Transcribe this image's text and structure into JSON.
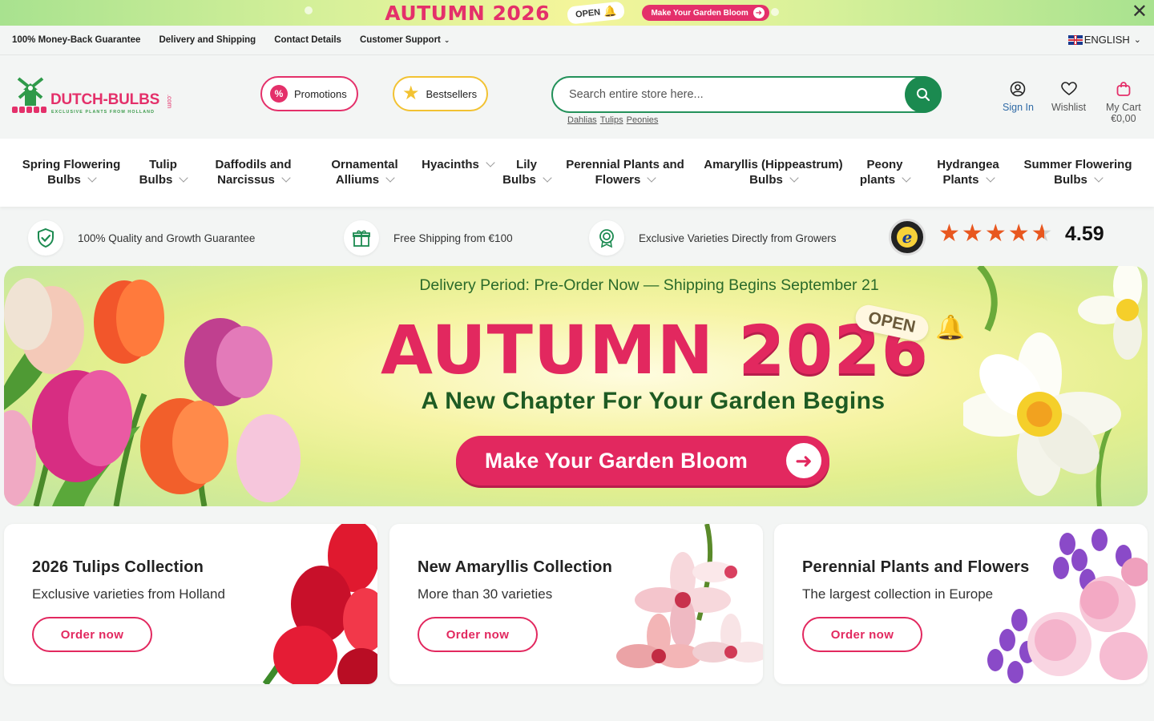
{
  "promo_strip": {
    "title": "AUTUMN 2026",
    "open_label": "OPEN",
    "cta_label": "Make Your Garden Bloom",
    "close_label": "✕"
  },
  "util_bar": {
    "links": [
      "100% Money-Back Guarantee",
      "Delivery and Shipping",
      "Contact Details",
      "Customer Support"
    ],
    "language": "ENGLISH"
  },
  "header": {
    "brand": "DUTCH-BULBS",
    "brand_suffix": ".com",
    "tagline": "EXCLUSIVE PLANTS FROM HOLLAND",
    "promotions_label": "Promotions",
    "bestsellers_label": "Bestsellers",
    "search_placeholder": "Search entire store here...",
    "quick_links": [
      "Dahlias",
      "Tulips",
      "Peonies"
    ],
    "sign_in": "Sign In",
    "wishlist": "Wishlist",
    "cart_label": "My Cart",
    "cart_total": "€0,00"
  },
  "nav": {
    "items": [
      {
        "l1": "Spring Flowering",
        "l2": "Bulbs"
      },
      {
        "l1": "Tulip",
        "l2": "Bulbs"
      },
      {
        "l1": "Daffodils and",
        "l2": "Narcissus"
      },
      {
        "l1": "Ornamental",
        "l2": "Alliums"
      },
      {
        "l1": "Hyacinths",
        "l2": ""
      },
      {
        "l1": "Lily",
        "l2": "Bulbs"
      },
      {
        "l1": "Perennial Plants and",
        "l2": "Flowers"
      },
      {
        "l1": "Amaryllis (Hippeastrum)",
        "l2": "Bulbs"
      },
      {
        "l1": "Peony",
        "l2": "plants"
      },
      {
        "l1": "Hydrangea",
        "l2": "Plants"
      },
      {
        "l1": "Summer Flowering",
        "l2": "Bulbs"
      }
    ]
  },
  "trust": {
    "items": [
      "100% Quality and Growth Guarantee",
      "Free Shipping from €100",
      "Exclusive Varieties Directly from Growers"
    ],
    "rating": "4.59",
    "rating_value": 4.59,
    "rating_max": 5
  },
  "hero": {
    "delivery": "Delivery Period: Pre-Order Now — Shipping Begins September 21",
    "headline_word": "AUTUMN",
    "headline_year": "2026",
    "open_label": "OPEN",
    "subtitle": "A New Chapter For Your Garden Begins",
    "cta_label": "Make Your Garden Bloom",
    "colors": {
      "accent": "#e2285f",
      "green": "#1e5b23"
    }
  },
  "cards": [
    {
      "title": "2026 Tulips Collection",
      "desc": "Exclusive varieties from Holland",
      "button": "Order now"
    },
    {
      "title": "New Amaryllis Collection",
      "desc": "More than 30 varieties",
      "button": "Order now"
    },
    {
      "title": "Perennial Plants and Flowers",
      "desc": "The largest collection in Europe",
      "button": "Order now"
    }
  ]
}
